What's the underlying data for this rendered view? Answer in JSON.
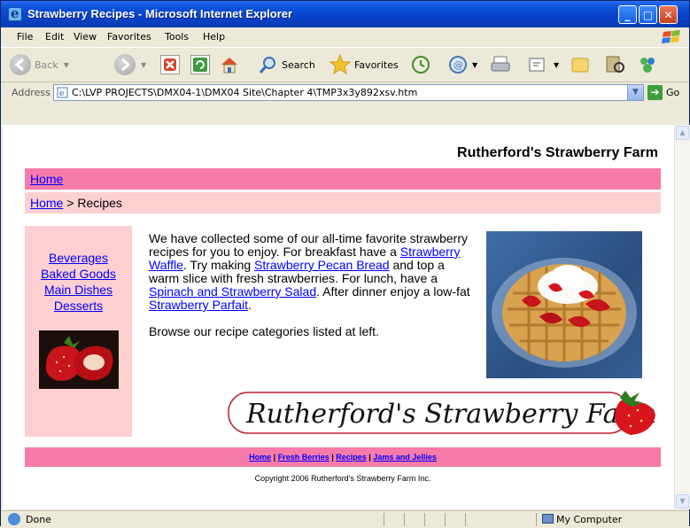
{
  "window": {
    "title": "Strawberry Recipes - Microsoft Internet Explorer",
    "controls": {
      "minimize": "_",
      "maximize": "□",
      "close": "✕"
    }
  },
  "menu": [
    "File",
    "Edit",
    "View",
    "Favorites",
    "Tools",
    "Help"
  ],
  "toolbar": {
    "back": "Back",
    "search": "Search",
    "favorites": "Favorites"
  },
  "address": {
    "label": "Address",
    "url": "C:\\LVP PROJECTS\\DMX04-1\\DMX04 Site\\Chapter 4\\TMP3x3y892xsv.htm",
    "go": "Go"
  },
  "page": {
    "brand": "Rutherford's Strawberry Farm",
    "nav_home": "Home",
    "breadcrumb": {
      "home": "Home",
      "separator": " > ",
      "current": "Recipes"
    },
    "sidebar_links": [
      "Beverages",
      "Baked Goods",
      "Main Dishes",
      "Desserts"
    ],
    "intro": {
      "p1": "We have collected some of our all-time favorite strawberry recipes for you to enjoy. For breakfast have a ",
      "link1": "Strawberry Waffle",
      "p2": ". Try making ",
      "link2": "Strawberry Pecan Bread",
      "p3": " and top a warm slice with fresh strawberries. For lunch, have a ",
      "link3": "Spinach and Strawberry Salad",
      "p4": ". After dinner enjoy a low-fat ",
      "link4": "Strawberry Parfait",
      "p5": "."
    },
    "browse": "Browse our recipe categories listed at left.",
    "logo_text": "Rutherford's Strawberry Farm",
    "footer_links": [
      "Home",
      "Fresh Berries",
      "Recipes",
      "Jams and Jellies"
    ],
    "footer_sep": " | ",
    "copyright": "Copyright 2006 Rutherford's Strawberry Farm Inc."
  },
  "status": {
    "left": "Done",
    "zone": "My Computer"
  },
  "colors": {
    "nav_pink": "#F77BAA",
    "light_pink": "#FDD0D0",
    "link": "#0000FF",
    "titlebar": "#0A4FD8"
  }
}
